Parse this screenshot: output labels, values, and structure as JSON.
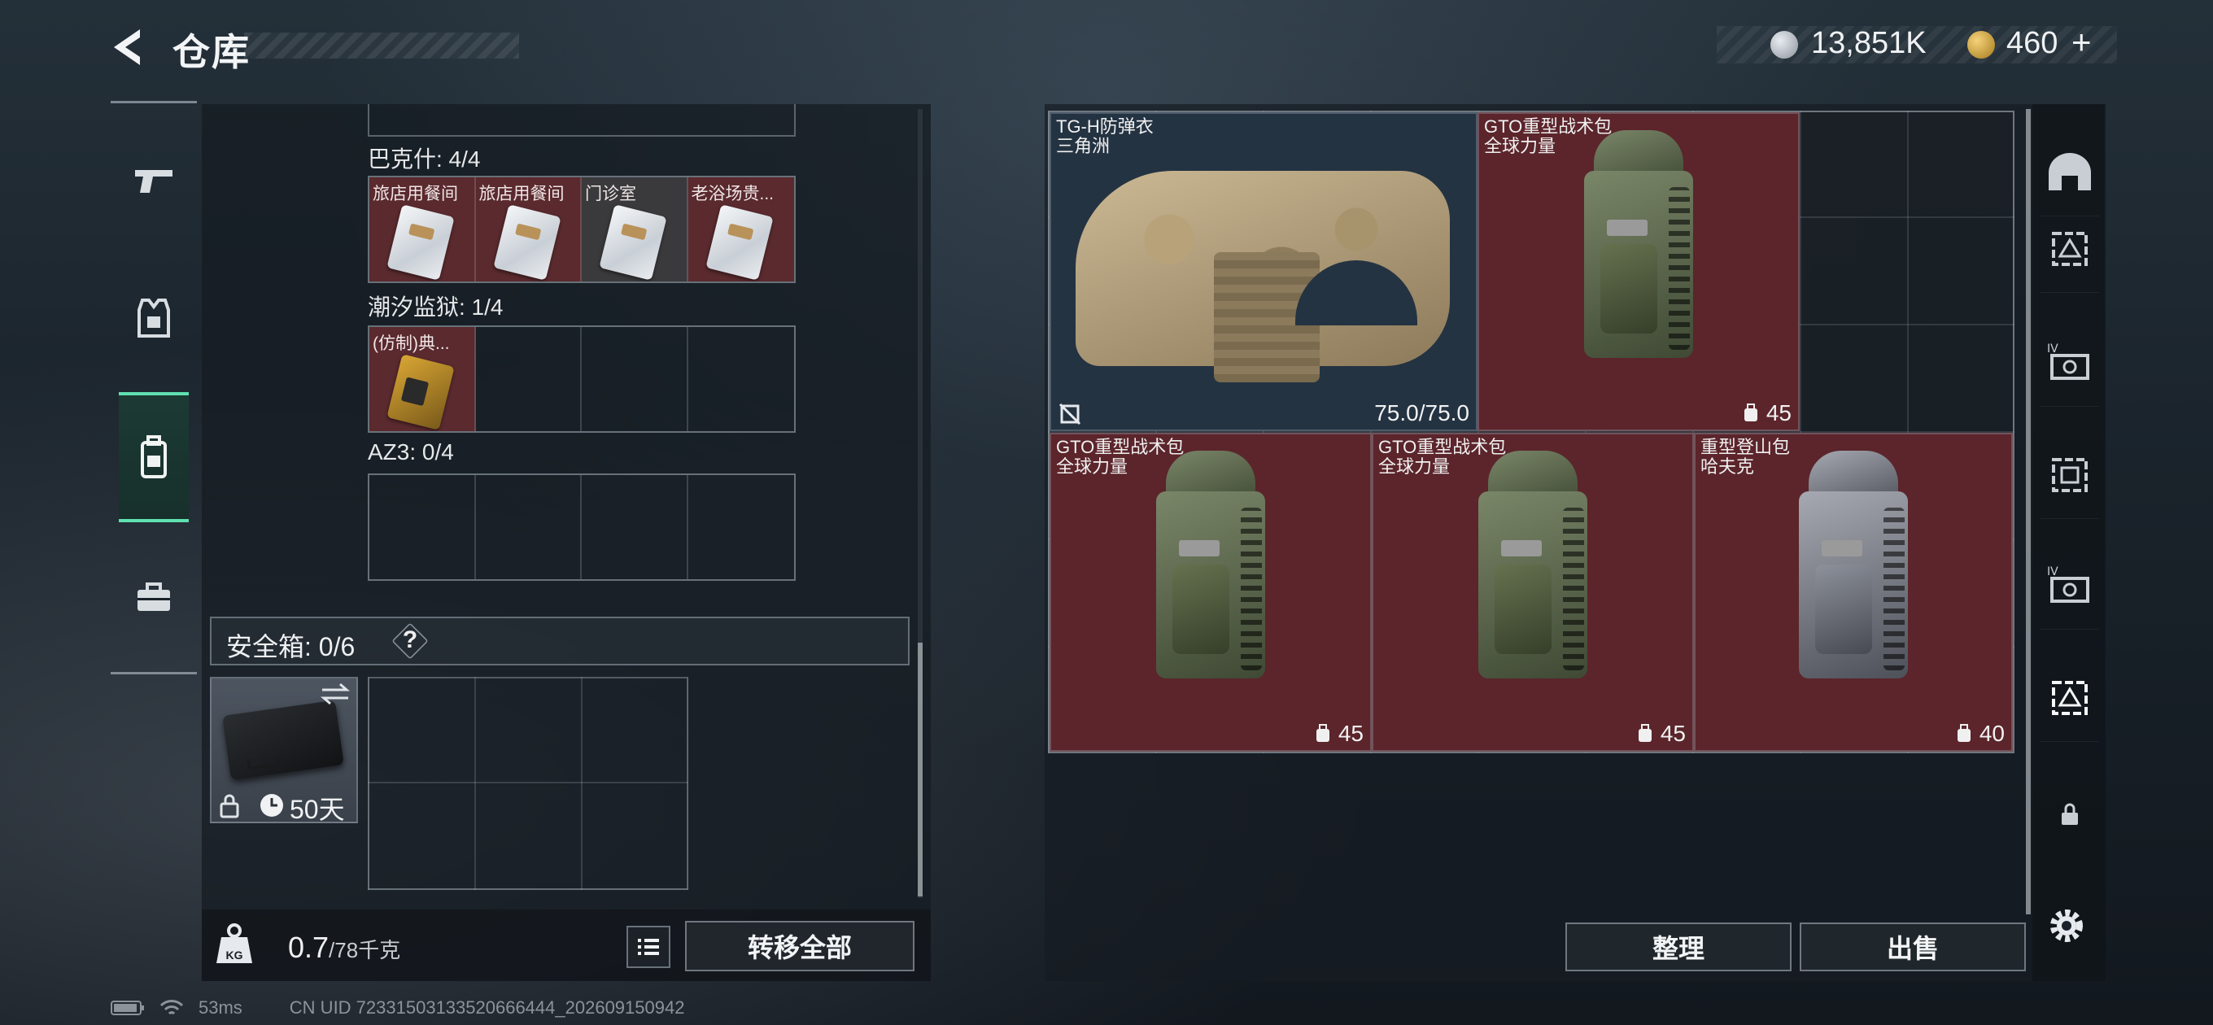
{
  "header": {
    "title": "仓库",
    "currency_coin": "13,851K",
    "currency_gem": "460",
    "add_symbol": "+"
  },
  "left_rail": {
    "items": [
      {
        "name": "weapons",
        "icon": "pistol-icon"
      },
      {
        "name": "armor",
        "icon": "vest-icon"
      },
      {
        "name": "backpack",
        "icon": "backpack-icon",
        "active": true
      },
      {
        "name": "case",
        "icon": "briefcase-icon"
      }
    ]
  },
  "key_groups": [
    {
      "label": "巴克什: 4/4",
      "slots": [
        "旅店用餐间",
        "旅店用餐间",
        "门诊室",
        "老浴场贵..."
      ]
    },
    {
      "label": "潮汐监狱: 1/4",
      "slots": [
        "(仿制)典..."
      ]
    },
    {
      "label": "AZ3: 0/4",
      "slots": []
    }
  ],
  "safe_box": {
    "title": "安全箱: 0/6",
    "help": "?",
    "duration": "50天"
  },
  "footer": {
    "weight_value": "0.7",
    "weight_max": "/78千克",
    "weight_icon_label": "KG",
    "transfer_all": "转移全部",
    "organize": "整理",
    "sell": "出售"
  },
  "items": [
    {
      "name": "TG-H防弹衣",
      "subtitle": "三角洲",
      "value": "75.0/75.0",
      "color": "#243342"
    },
    {
      "name": "GTO重型战术包",
      "subtitle": "全球力量",
      "value": "45",
      "color": "#5b252b"
    },
    {
      "name": "GTO重型战术包",
      "subtitle": "全球力量",
      "value": "45",
      "color": "#5b252b"
    },
    {
      "name": "GTO重型战术包",
      "subtitle": "全球力量",
      "value": "45",
      "color": "#5b252b"
    },
    {
      "name": "重型登山包",
      "subtitle": "哈夫克",
      "value": "40",
      "color": "#5b252b"
    }
  ],
  "right_rail": {
    "items": [
      "helmet-icon",
      "armor-slot-icon",
      "chest-rig-iv-icon",
      "chest-rig-icon",
      "chest-rig-iv-icon-2",
      "chest-rig-active-icon",
      "lock-icon"
    ]
  },
  "status": {
    "ping": "53ms",
    "uid": "CN UID 72331503133520666444_202609150942"
  },
  "colors": {
    "accent": "#5fe0b0",
    "red_tile": "#5b252b",
    "blue_tile": "#243342"
  }
}
